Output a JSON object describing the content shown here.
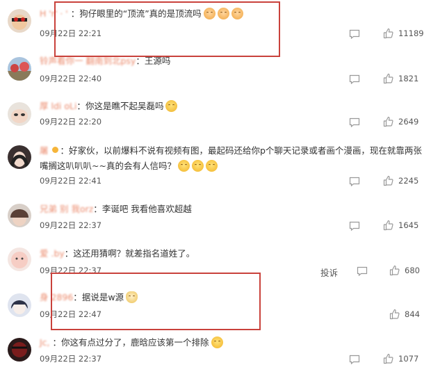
{
  "comments": [
    {
      "name": "H 'r' ·  ' ",
      "sep": "：",
      "text": "狗仔眼里的“顶流”真的是顶流吗",
      "emojis": [
        "kiss",
        "kiss",
        "kiss"
      ],
      "time": "09月22日 22:21",
      "likes": "11189"
    },
    {
      "name": "铃声看你一 翻南到北psy",
      "sep": "：",
      "text": "王源吗",
      "emojis": [],
      "time": "09月22日 22:40",
      "likes": "1821"
    },
    {
      "name": "厚 ldi oLi",
      "sep": "：",
      "text": "你这是瞧不起吴磊吗",
      "emojis": [
        "cry"
      ],
      "time": "09月22日 22:20",
      "likes": "2649"
    },
    {
      "name": "屠    ",
      "sep": "：",
      "text": "好家伙，以前爆料不说有视频有图，最起码还给你p个聊天记录或者画个漫画，现在就靠两张嘴搁这叭叭叭~~真的会有人信吗？",
      "emojis": [
        "laugh",
        "laugh",
        "laugh"
      ],
      "time": "09月22日 22:41",
      "likes": "2245"
    },
    {
      "name": "兄弟 别 我orz",
      "sep": "：",
      "text": "李诞吧 我看他喜欢超越",
      "emojis": [],
      "time": "09月22日 22:37",
      "likes": "1645"
    },
    {
      "name": "爱  .by",
      "sep": "：",
      "text": "这还用猜啊？就差指名道姓了。",
      "emojis": [],
      "time": "09月22日 22:37",
      "likes": "680",
      "report": "投诉"
    },
    {
      "name": "身      2896",
      "sep": "：",
      "text": "据说是w源",
      "emojis": [
        "cat"
      ],
      "time": "09月22日 22:47",
      "likes": "844"
    },
    {
      "name": "Jc, ",
      "sep": "：",
      "text": "你这有点过分了，鹿晗应该第一个排除",
      "emojis": [
        "laugh"
      ],
      "time": "09月22日 22:37",
      "likes": "1077"
    }
  ],
  "colors": {
    "name": "#eb7350",
    "highlight": "#c9413b"
  },
  "icons": {
    "reply": "comment-icon",
    "like": "thumbs-up-icon",
    "badge": "vip-badge-icon"
  }
}
